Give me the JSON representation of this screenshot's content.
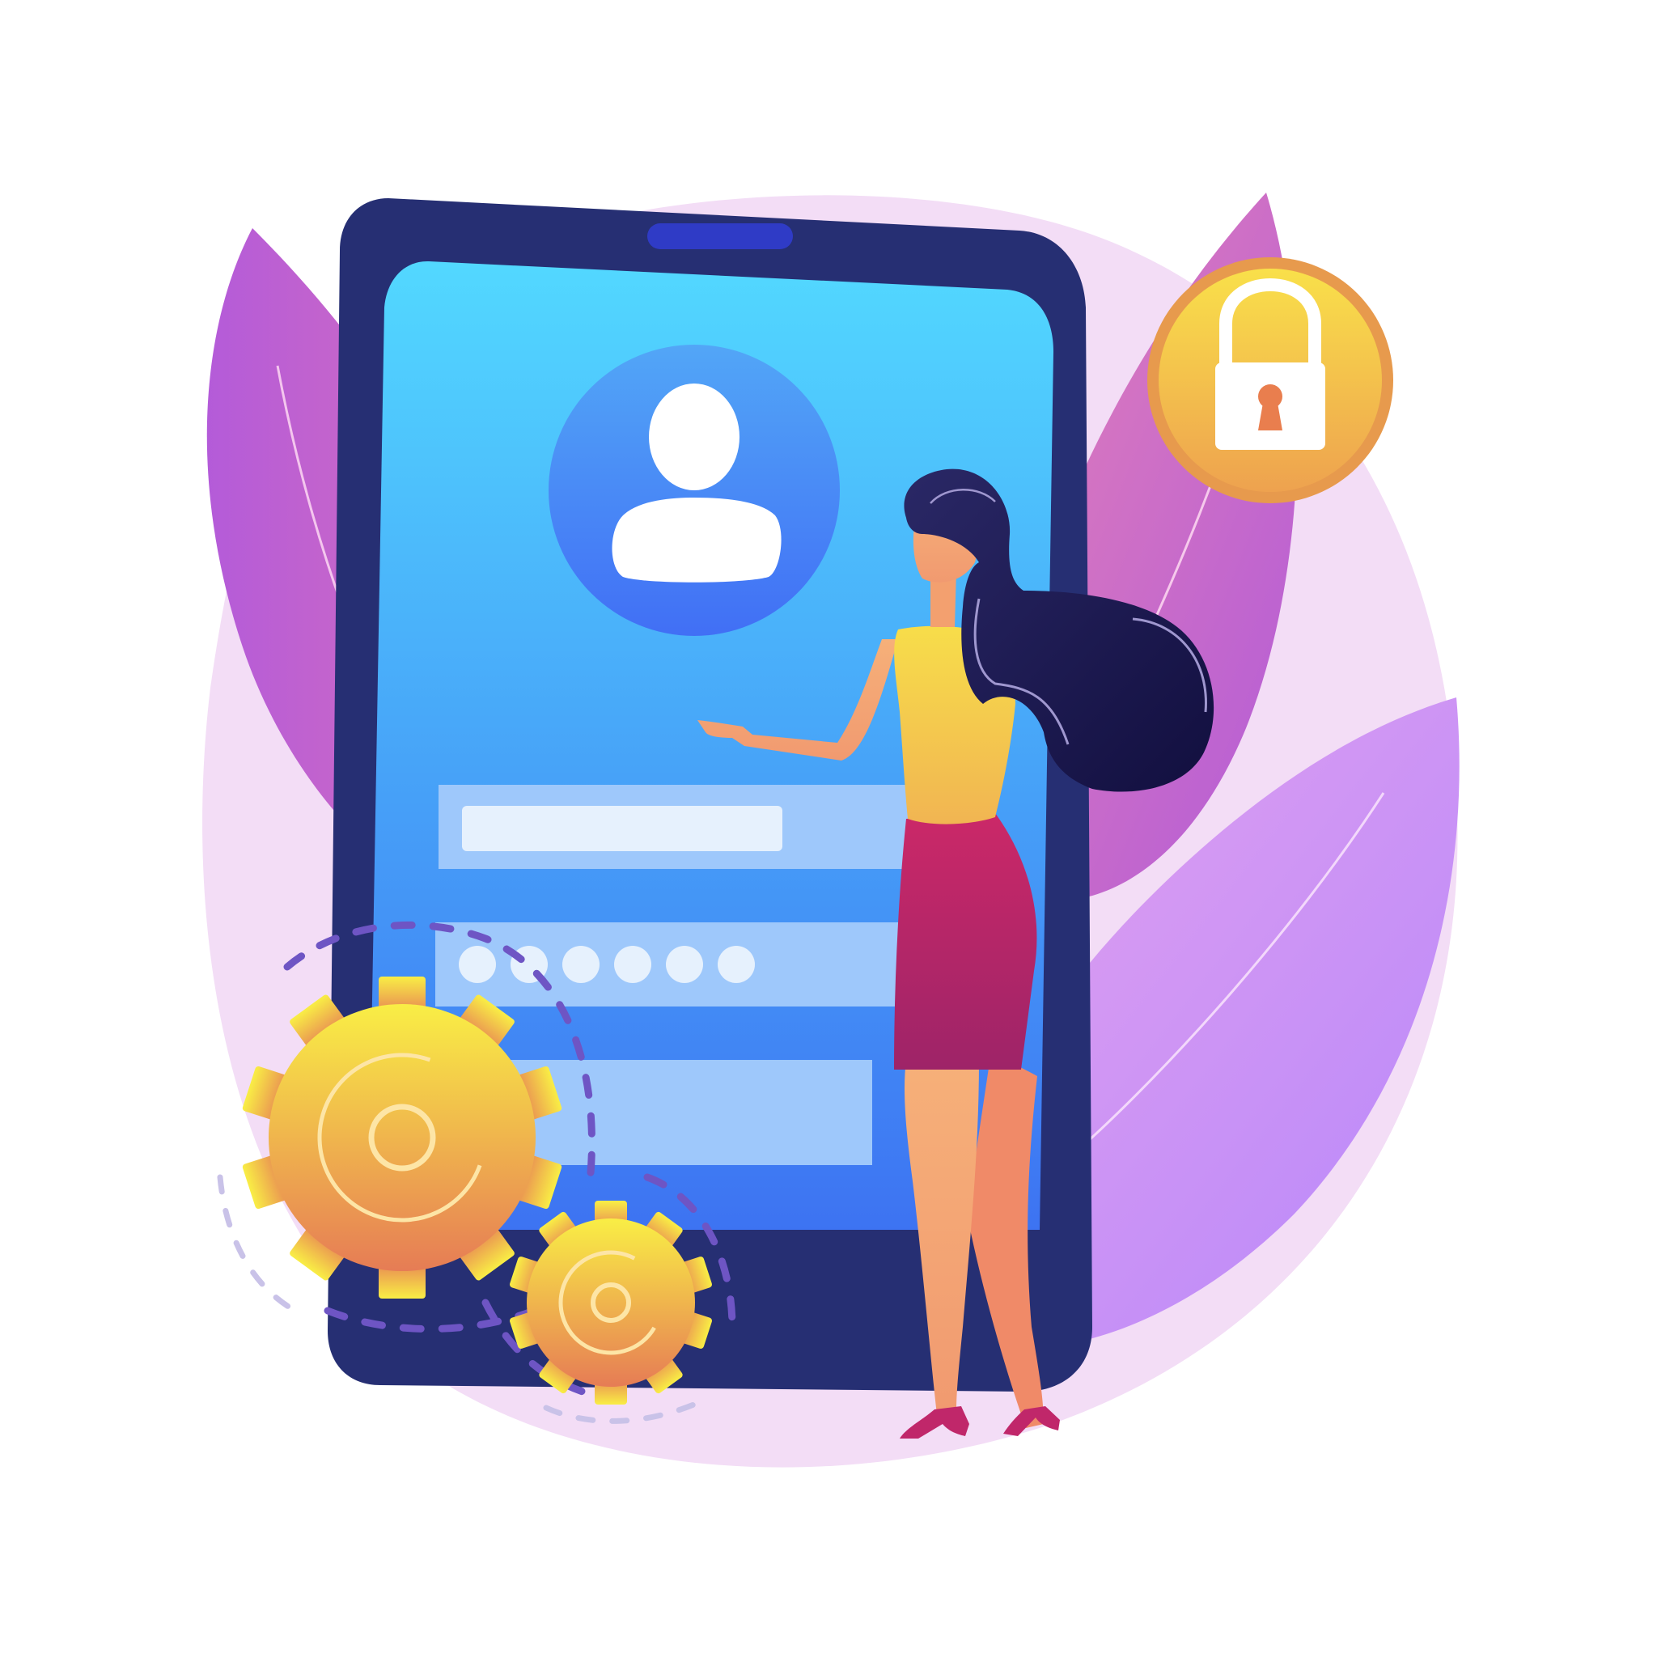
{
  "illustration": {
    "colors": {
      "background": "#ffffff",
      "blob": "#f3ddf6",
      "leaf_pink_top": "#d66fbd",
      "leaf_purple": "#b45fd8",
      "leaf_lilac": "#c48cf6",
      "phone_body": "#262f73",
      "phone_notch": "#2f3bc6",
      "screen_top": "#52d8ff",
      "screen_bottom": "#3d73f2",
      "avatar_circle": "#4a86f5",
      "field_light": "#9ec8fb",
      "field_inner": "#e6f1fd",
      "lock_gold": "#f5c843",
      "lock_ring": "#e79a4d",
      "keyhole": "#e97e4e",
      "gear_top": "#f8e64a",
      "gear_bottom": "#e88452",
      "hair": "#1b1447",
      "top": "#f5cf4b",
      "skirt": "#c0276a",
      "skin": "#f5a474",
      "shoes": "#c0276a"
    },
    "icons": [
      "user-avatar-icon",
      "padlock-icon",
      "gear-icon"
    ],
    "password_dot_count": 6,
    "login_fields": [
      "username-field",
      "password-field",
      "submit-field"
    ]
  }
}
